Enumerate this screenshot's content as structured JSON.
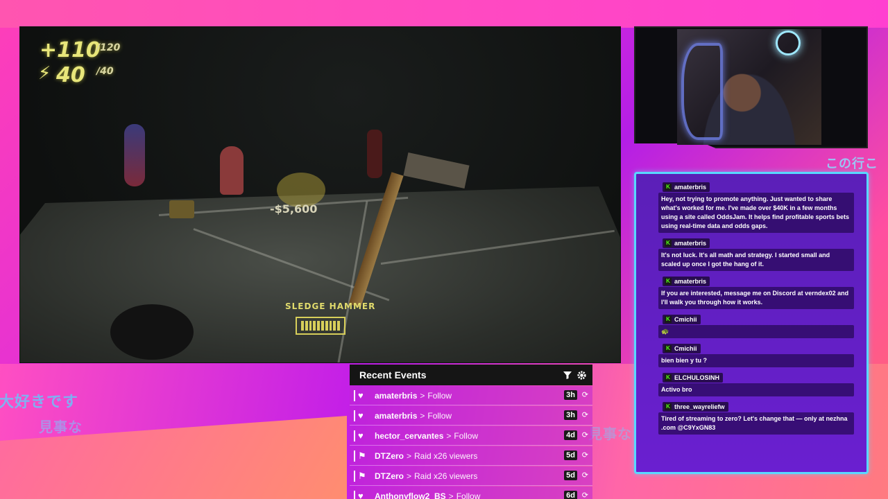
{
  "game_hud": {
    "health": "+110",
    "health_max": "/120",
    "energy": "40",
    "energy_max": "/40",
    "money_popup": "-$5,600",
    "weapon_name": "SLEDGE HAMMER"
  },
  "overlay_text": {
    "jp_left_1": "大好きです",
    "jp_left_2": "見事な",
    "jp_bottom": "見事な",
    "jp_top_right": "この行こ"
  },
  "chat": {
    "messages": [
      {
        "user": "amaterbris",
        "text": "Hey, not trying to promote anything. Just wanted to share what's worked for me. I've made over $40K in a few months using a site called OddsJam. It helps find profitable sports bets using real-time data and odds gaps."
      },
      {
        "user": "amaterbris",
        "text": "It's not luck. It's all math and strategy. I started small and scaled up once I got the hang of it."
      },
      {
        "user": "amaterbris",
        "text": "If you are interested, message me on Discord at verndex02 and I'll walk you through how it works."
      },
      {
        "user": "Cmichii",
        "text": "🐢"
      },
      {
        "user": "Cmichii",
        "text": "bien bien y tu ?"
      },
      {
        "user": "ELCHULOSINH",
        "text": "Activo bro"
      },
      {
        "user": "three_wayreliefw",
        "text": "Tired of streaming to zero? Let's change that — only at nezhna .com @C9YxGN83"
      }
    ]
  },
  "events": {
    "title": "Recent Events",
    "rows": [
      {
        "icon": "♥",
        "user": "amaterbris",
        "action": "Follow",
        "time": "3h"
      },
      {
        "icon": "♥",
        "user": "amaterbris",
        "action": "Follow",
        "time": "3h"
      },
      {
        "icon": "♥",
        "user": "hector_cervantes",
        "action": "Follow",
        "time": "4d"
      },
      {
        "icon": "⚑",
        "user": "DTZero",
        "action": "Raid x26 viewers",
        "time": "5d"
      },
      {
        "icon": "⚑",
        "user": "DTZero",
        "action": "Raid x26 viewers",
        "time": "5d"
      },
      {
        "icon": "♥",
        "user": "Anthonyflow2_BS",
        "action": "Follow",
        "time": "6d"
      }
    ]
  }
}
